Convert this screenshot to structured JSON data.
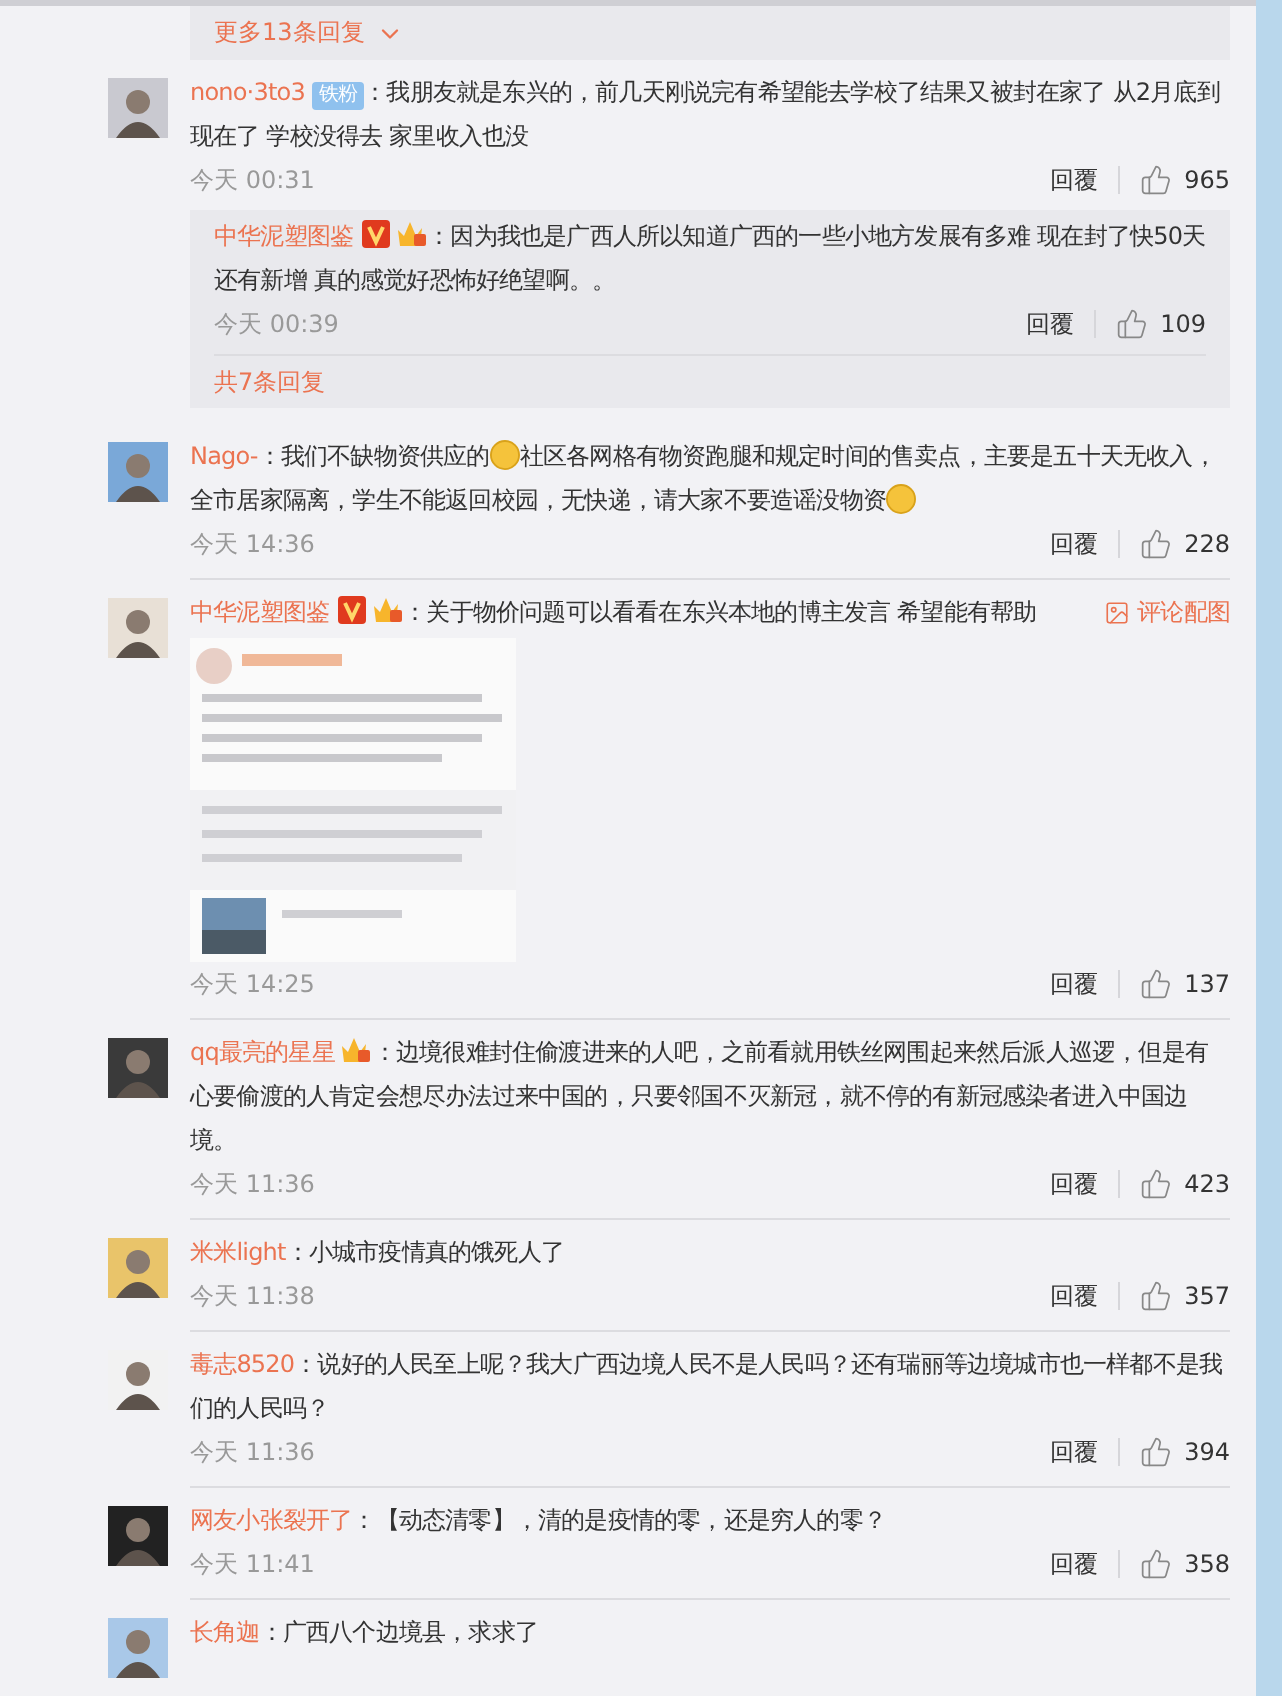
{
  "top_more": {
    "label": "更多13条回复"
  },
  "comments": [
    {
      "name": "nono·3to3",
      "badges": [
        {
          "kind": "fan",
          "label": "铁粉"
        }
      ],
      "text": [
        {
          "kind": "text",
          "value": "：我朋友就是东兴的，前几天刚说完有希望能去学校了结果又被封在家了 从2月底到现在了 学校没得去 家里收入也没"
        }
      ],
      "time": "今天 00:31",
      "reply_label": "回覆",
      "likes": "965",
      "replies": [
        {
          "name": "中华泥塑图鉴",
          "badges": [
            {
              "kind": "verified"
            },
            {
              "kind": "crown"
            }
          ],
          "text": [
            {
              "kind": "text",
              "value": "：因为我也是广西人所以知道广西的一些小地方发展有多难 现在封了快50天还有新增 真的感觉好恐怖好绝望啊。。"
            }
          ],
          "time": "今天 00:39",
          "reply_label": "回覆",
          "likes": "109"
        }
      ],
      "replies_more": "共7条回复"
    },
    {
      "name": "Nago-",
      "text": [
        {
          "kind": "text",
          "value": "：我们不缺物资供应的"
        },
        {
          "kind": "emoji"
        },
        {
          "kind": "text",
          "value": "社区各网格有物资跑腿和规定时间的售卖点，主要是五十天无收入，全市居家隔离，学生不能返回校园，无快递，请大家不要造谣没物资"
        },
        {
          "kind": "emoji"
        }
      ],
      "time": "今天 14:36",
      "reply_label": "回覆",
      "likes": "228"
    },
    {
      "name": "中华泥塑图鉴",
      "badges": [
        {
          "kind": "verified"
        },
        {
          "kind": "crown"
        }
      ],
      "text": [
        {
          "kind": "text",
          "value": "：关于物价问题可以看看在东兴本地的博主发言 希望能有帮助"
        }
      ],
      "image_link": "评论配图",
      "image": {
        "kind": "picture"
      },
      "time": "今天 14:25",
      "reply_label": "回覆",
      "likes": "137"
    },
    {
      "name": "qq最亮的星星",
      "badges": [
        {
          "kind": "crown"
        }
      ],
      "text": [
        {
          "kind": "text",
          "value": "：边境很难封住偷渡进来的人吧，之前看就用铁丝网围起来然后派人巡逻，但是有心要偷渡的人肯定会想尽办法过来中国的，只要邻国不灭新冠，就不停的有新冠感染者进入中国边境。"
        }
      ],
      "time": "今天 11:36",
      "reply_label": "回覆",
      "likes": "423"
    },
    {
      "name": "米米light",
      "text": [
        {
          "kind": "text",
          "value": "：小城市疫情真的饿死人了"
        }
      ],
      "time": "今天 11:38",
      "reply_label": "回覆",
      "likes": "357"
    },
    {
      "name": "毒志8520",
      "text": [
        {
          "kind": "text",
          "value": "：说好的人民至上呢？我大广西边境人民不是人民吗？还有瑞丽等边境城市也一样都不是我们的人民吗？"
        }
      ],
      "time": "今天 11:36",
      "reply_label": "回覆",
      "likes": "394"
    },
    {
      "name": "网友小张裂开了",
      "text": [
        {
          "kind": "text",
          "value": "：【动态清零】，清的是疫情的零，还是穷人的零？"
        }
      ],
      "time": "今天 11:41",
      "reply_label": "回覆",
      "likes": "358"
    },
    {
      "name": "长角迦",
      "text": [
        {
          "kind": "text",
          "value": "：广西八个边境县，求求了"
        }
      ]
    }
  ]
}
